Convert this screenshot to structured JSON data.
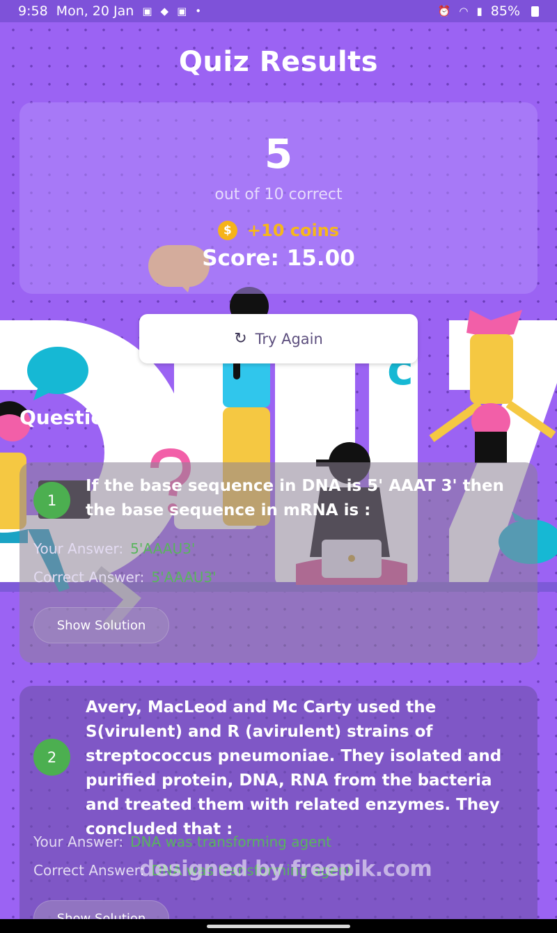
{
  "status_bar": {
    "time": "9:58",
    "date": "Mon, 20 Jan",
    "battery": "85%",
    "icons_left": [
      "gallery-icon",
      "cat-icon",
      "photo-icon",
      "dot-icon"
    ],
    "icons_right": [
      "alarm-icon",
      "wifi-icon",
      "signal-icon",
      "battery-icon"
    ]
  },
  "header": {
    "title": "Quiz Results"
  },
  "score_card": {
    "correct_count": "5",
    "out_of_text": "out of 10 correct",
    "coins_symbol": "$",
    "coins_text": "+10 coins",
    "score_text": "Score: 15.00"
  },
  "actions": {
    "retry_icon": "↻",
    "retry_label": "Try Again"
  },
  "details": {
    "title": "Question Details",
    "your_answer_label": "Your Answer:",
    "correct_answer_label": "Correct Answer:",
    "solution_label": "Show Solution",
    "questions": [
      {
        "number": "1",
        "text": "If the base sequence in DNA is 5' AAAT 3' then the base sequence in mRNA is :",
        "your_answer": "5'AAAU3'",
        "correct_answer": "5'AAAU3'"
      },
      {
        "number": "2",
        "text": "Avery, MacLeod and Mc Carty used the S(virulent) and R (avirulent) strains of streptococcus pneumoniae. They isolated and purified protein, DNA, RNA from the bacteria and treated them with related enzymes. They concluded that :",
        "your_answer": "DNA was transforming agent",
        "correct_answer": "DNA was transforming agent"
      }
    ]
  },
  "background_art": {
    "word": "QUIZ",
    "watermark": "designed by freepik.com"
  },
  "colors": {
    "background": "#9b63f3",
    "accent_green": "#4caf50",
    "coin_gold": "#f6b31a",
    "white": "#ffffff"
  }
}
